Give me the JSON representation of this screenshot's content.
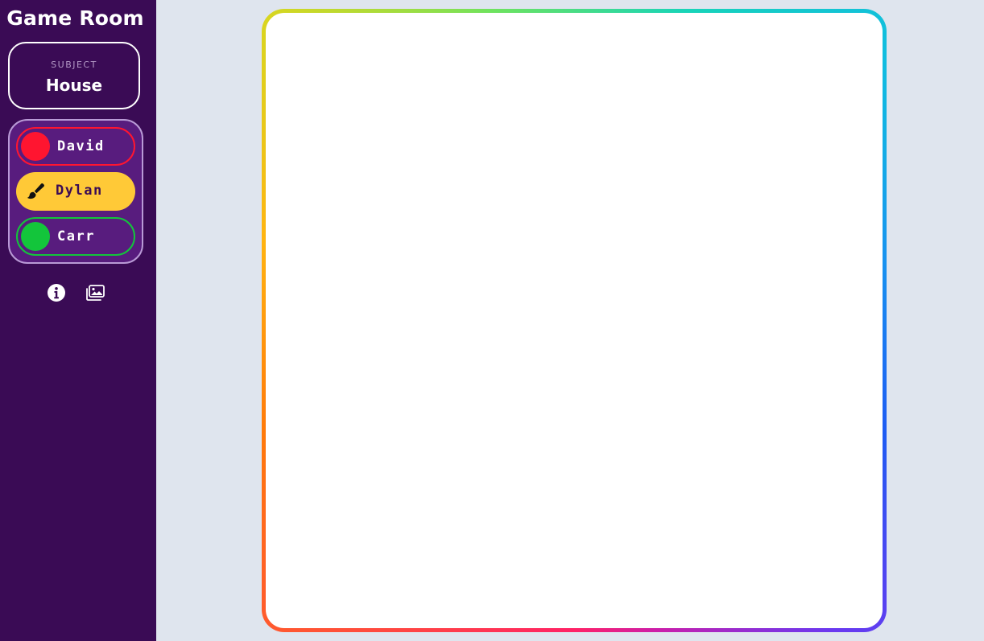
{
  "app": {
    "title": "Game Room"
  },
  "subject": {
    "label": "SUBJECT",
    "value": "House"
  },
  "players": [
    {
      "name": "David",
      "color": "#ff1530",
      "state": "waiting"
    },
    {
      "name": "Dylan",
      "color": "#ffc937",
      "state": "drawing",
      "icon": "paintbrush-icon"
    },
    {
      "name": "Carr",
      "color": "#13c53b",
      "state": "waiting"
    }
  ],
  "toolbar": {
    "info_icon": "info-icon",
    "gallery_icon": "gallery-icon"
  },
  "canvas": {
    "background": "#ffffff"
  },
  "colors": {
    "sidebar": "#3a0b55",
    "panel": "#581c7e",
    "page": "#dfe5ee"
  }
}
